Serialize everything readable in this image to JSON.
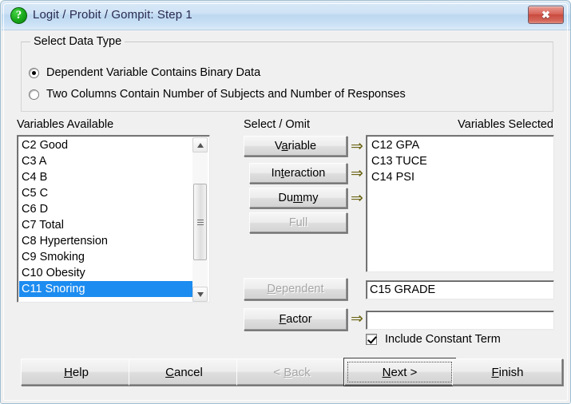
{
  "window": {
    "title": "Logit / Probit / Gompit: Step 1",
    "app_icon": "question-mark-icon",
    "icon_glyph": "?",
    "close_label": "✖",
    "accent_title_color": "#2a2a52",
    "close_button_color": "#c94a3e",
    "selection_color": "#1c8cf0"
  },
  "data_type_group": {
    "legend": "Select Data Type",
    "options": [
      {
        "label": "Dependent Variable Contains Binary Data",
        "checked": true
      },
      {
        "label": "Two Columns Contain Number of Subjects and Number of Responses",
        "checked": false
      }
    ]
  },
  "available": {
    "heading": "Variables Available",
    "items": [
      {
        "label": "C2 Good",
        "selected": false
      },
      {
        "label": "C3 A",
        "selected": false
      },
      {
        "label": "C4 B",
        "selected": false
      },
      {
        "label": "C5 C",
        "selected": false
      },
      {
        "label": "C6 D",
        "selected": false
      },
      {
        "label": "C7 Total",
        "selected": false
      },
      {
        "label": "C8 Hypertension",
        "selected": false
      },
      {
        "label": "C9 Smoking",
        "selected": false
      },
      {
        "label": "C10 Obesity",
        "selected": false
      },
      {
        "label": "C11 Snoring",
        "selected": true
      }
    ]
  },
  "select_omit": {
    "heading": "Select / Omit",
    "arrow_glyph": "⇒",
    "buttons": [
      {
        "name": "variable",
        "label": "Variable",
        "mnemonic": "a",
        "enabled": true,
        "arrow": true
      },
      {
        "name": "interaction",
        "label": "Interaction",
        "mnemonic": "t",
        "enabled": true,
        "arrow": true
      },
      {
        "name": "dummy",
        "label": "Dummy",
        "mnemonic": "m",
        "enabled": true,
        "arrow": true
      },
      {
        "name": "full",
        "label": "Full",
        "mnemonic": "",
        "enabled": false,
        "arrow": false
      },
      {
        "name": "dependent",
        "label": "Dependent",
        "mnemonic": "D",
        "enabled": false,
        "arrow": false
      },
      {
        "name": "factor",
        "label": "Factor",
        "mnemonic": "F",
        "enabled": true,
        "arrow": true
      }
    ]
  },
  "selected": {
    "heading": "Variables Selected",
    "items": [
      {
        "label": "C12 GPA"
      },
      {
        "label": "C13 TUCE"
      },
      {
        "label": "C14 PSI"
      }
    ],
    "dependent_value": "C15 GRADE",
    "factor_value": ""
  },
  "constant_term": {
    "label": "Include Constant Term",
    "checked": true
  },
  "footer": {
    "buttons": [
      {
        "name": "help",
        "label": "Help",
        "enabled": true,
        "default": false
      },
      {
        "name": "cancel",
        "label": "Cancel",
        "enabled": true,
        "default": false
      },
      {
        "name": "back",
        "label": "< Back",
        "enabled": false,
        "default": false
      },
      {
        "name": "next",
        "label": "Next >",
        "enabled": true,
        "default": true
      },
      {
        "name": "finish",
        "label": "Finish",
        "enabled": true,
        "default": false
      }
    ]
  }
}
